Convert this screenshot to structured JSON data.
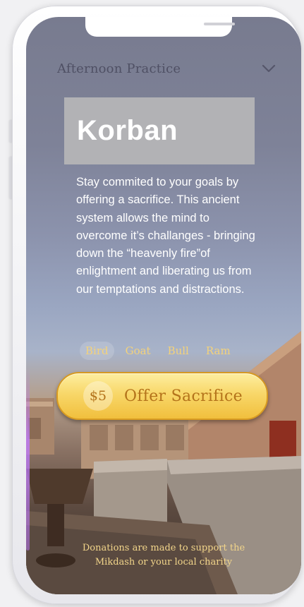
{
  "header": {
    "dropdown_label": "Afternoon Practice",
    "chevron_icon": "chevron-down-icon"
  },
  "card": {
    "title": "Korban",
    "description": "Stay commited to your goals by offering a sacrifice. This ancient system allows the mind to overcome it’s challanges - bringing down the “heavenly fire”of enlightment and liberating us from our temptations and distractions."
  },
  "offerings": {
    "selected": "Bird",
    "items": [
      {
        "label": "Bird"
      },
      {
        "label": "Goat"
      },
      {
        "label": "Bull"
      },
      {
        "label": "Ram"
      }
    ]
  },
  "offer_button": {
    "price": "$5",
    "label": "Offer Sacrifice"
  },
  "footer": {
    "line1": "Donations are made to support the",
    "line2": "Mikdash or your local charity"
  },
  "colors": {
    "accent_gold": "#f4d27a",
    "button_text": "#b4731b",
    "title_box": "#b2b2b5"
  }
}
